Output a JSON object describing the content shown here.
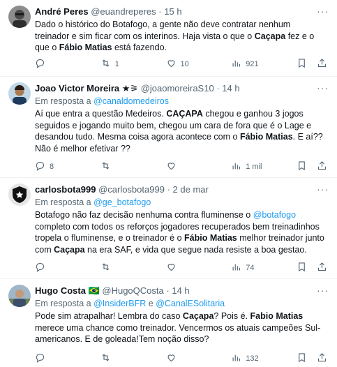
{
  "tweets": [
    {
      "name": "André Peres",
      "handle": "@euandreperes",
      "sep": "·",
      "time": "15 h",
      "reply_prefix": "",
      "reply_to": [],
      "segments": [
        {
          "t": "Dado o histórico do Botafogo, a gente não deve contratar nenhum"
        },
        {
          "br": true
        },
        {
          "t": "treinador e sim ficar com os interinos. Haja vista o que o "
        },
        {
          "b": "Caçapa"
        },
        {
          "t": " fez e o"
        },
        {
          "br": true
        },
        {
          "t": "que o "
        },
        {
          "b": "Fábio Matias"
        },
        {
          "t": " está fazendo."
        }
      ],
      "reply_count": "",
      "retweet_count": "1",
      "like_count": "10",
      "view_count": "921"
    },
    {
      "name": "Joao Victor Moreira",
      "name_badge": "★⚞",
      "handle": "@joaomoreiraS10",
      "sep": "·",
      "time": "14 h",
      "reply_prefix": "Em resposta a",
      "reply_to": [
        "@canaldomedeiros"
      ],
      "segments": [
        {
          "t": "Aí que entra a questão Medeiros. "
        },
        {
          "b": "CAÇAPA"
        },
        {
          "t": " chegou e ganhou 3 jogos"
        },
        {
          "br": true
        },
        {
          "t": "seguidos e jogando muito bem, chegou um cara de fora que é o Lage e"
        },
        {
          "br": true
        },
        {
          "t": "desandou tudo. Mesma coisa agora acontece com o "
        },
        {
          "b": "Fábio Matias"
        },
        {
          "t": ". E aí??"
        },
        {
          "br": true
        },
        {
          "t": "Não é melhor efetivar ??"
        }
      ],
      "reply_count": "8",
      "retweet_count": "",
      "like_count": "",
      "view_count": "1 mil"
    },
    {
      "name": "carlosbota999",
      "handle": "@carlosbota999",
      "sep": "·",
      "time": "2 de mar",
      "reply_prefix": "Em resposta a",
      "reply_to": [
        "@ge_botafogo"
      ],
      "segments": [
        {
          "t": "Botafogo não faz decisão nenhuma contra fluminense o "
        },
        {
          "l": "@botafogo"
        },
        {
          "br": true
        },
        {
          "t": "completo com todos os reforços jogadores recuperados bem treinadinhos"
        },
        {
          "br": true
        },
        {
          "t": "tropela o fluminense, e o treinador é o "
        },
        {
          "b": "Fábio Matias"
        },
        {
          "t": " melhor treinador junto"
        },
        {
          "br": true
        },
        {
          "t": "com "
        },
        {
          "b": "Caçapa"
        },
        {
          "t": " na era SAF, e vida que segue nada resiste a boa gestao."
        }
      ],
      "reply_count": "",
      "retweet_count": "",
      "like_count": "",
      "view_count": "74"
    },
    {
      "name": "Hugo Costa",
      "name_badge": "🇧🇷",
      "handle": "@HugoQCosta",
      "sep": "·",
      "time": "14 h",
      "reply_prefix": "Em resposta a",
      "reply_to": [
        "@InsiderBFR",
        "e",
        "@CanalESolitaria"
      ],
      "segments": [
        {
          "t": "Pode sim atrapalhar! Lembra do caso "
        },
        {
          "b": "Caçapa"
        },
        {
          "t": "? Pois é. "
        },
        {
          "b": "Fabio Matias"
        },
        {
          "br": true
        },
        {
          "t": "merece uma chance como treinador. Vencermos os atuais campeões Sul-"
        },
        {
          "br": true
        },
        {
          "t": "americanos. E de goleada!Tem noção disso?"
        }
      ],
      "reply_count": "",
      "retweet_count": "",
      "like_count": "",
      "view_count": "132"
    }
  ],
  "more_label": "···",
  "colors": {
    "link": "#1d9bf0",
    "muted": "#536471",
    "text": "#0f1419"
  },
  "icons": [
    "more-icon",
    "reply-icon",
    "retweet-icon",
    "like-icon",
    "views-icon",
    "bookmark-icon",
    "share-icon"
  ]
}
